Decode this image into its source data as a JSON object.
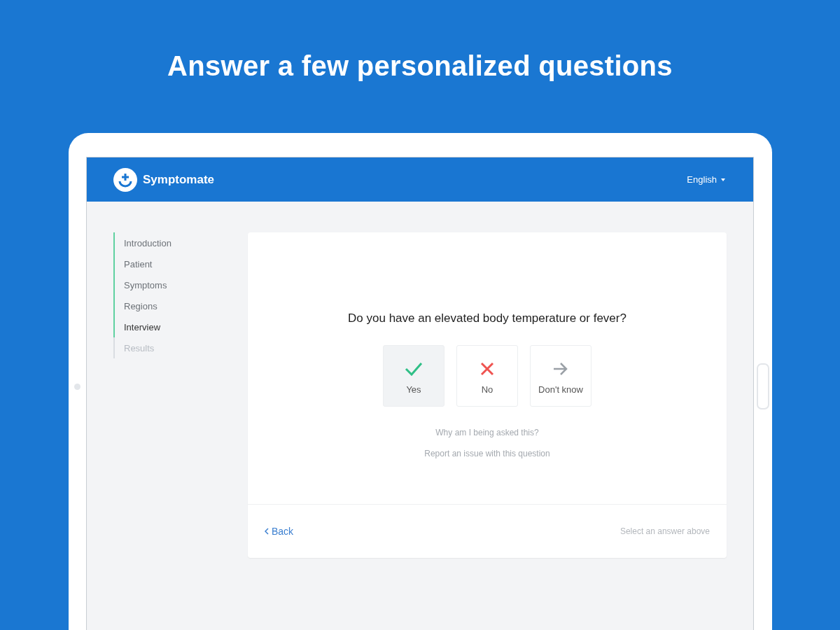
{
  "headline": "Answer a few personalized questions",
  "app": {
    "name": "Symptomate",
    "language": "English"
  },
  "steps": [
    {
      "label": "Introduction",
      "completed": true,
      "selected": false
    },
    {
      "label": "Patient",
      "completed": true,
      "selected": false
    },
    {
      "label": "Symptoms",
      "completed": true,
      "selected": false
    },
    {
      "label": "Regions",
      "completed": true,
      "selected": false
    },
    {
      "label": "Interview",
      "completed": true,
      "selected": true
    },
    {
      "label": "Results",
      "completed": false,
      "selected": false
    }
  ],
  "question": "Do you have an elevated body temperature or fever?",
  "answers": [
    {
      "kind": "yes",
      "label": "Yes",
      "selected": true
    },
    {
      "kind": "no",
      "label": "No",
      "selected": false
    },
    {
      "kind": "unknown",
      "label": "Don't know",
      "selected": false
    }
  ],
  "links": [
    "Why am I being asked this?",
    "Report an issue with this question"
  ],
  "footer": {
    "back": "Back",
    "hint": "Select an answer above"
  }
}
